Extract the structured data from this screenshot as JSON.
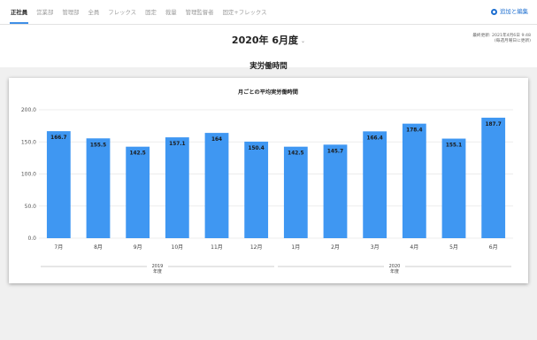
{
  "tabs": [
    {
      "label": "正社員",
      "active": true
    },
    {
      "label": "営業部",
      "active": false
    },
    {
      "label": "管理部",
      "active": false
    },
    {
      "label": "全員",
      "active": false
    },
    {
      "label": "フレックス",
      "active": false
    },
    {
      "label": "固定",
      "active": false
    },
    {
      "label": "裁量",
      "active": false
    },
    {
      "label": "管理監督者",
      "active": false
    },
    {
      "label": "固定+フレックス",
      "active": false
    }
  ],
  "toolbar": {
    "add_edit_label": "追加と編集"
  },
  "header": {
    "period": "2020年 6月度",
    "last_update": "最終更新: 2021年4月6日 9:48",
    "update_note": "(毎週月曜日に更新)"
  },
  "section_title": "実労働時間",
  "colors": {
    "bar": "#3f97f2",
    "accent": "#1e6fd0",
    "grid": "#e6e6e6"
  },
  "chart_data": {
    "type": "bar",
    "title": "月ごとの平均実労働時間",
    "categories": [
      "7月",
      "8月",
      "9月",
      "10月",
      "11月",
      "12月",
      "1月",
      "2月",
      "3月",
      "4月",
      "5月",
      "6月"
    ],
    "values": [
      166.7,
      155.5,
      142.5,
      157.1,
      164,
      150.4,
      142.5,
      145.7,
      166.4,
      178.4,
      155.1,
      187.7
    ],
    "value_labels": [
      "166.7",
      "155.5",
      "142.5",
      "157.1",
      "164",
      "150.4",
      "142.5",
      "145.7",
      "166.4",
      "178.4",
      "155.1",
      "187.7"
    ],
    "ylim": [
      0,
      200
    ],
    "yticks": [
      "0.0",
      "50.0",
      "100.0",
      "150.0",
      "200.0"
    ],
    "ytick_values": [
      0,
      50,
      100,
      150,
      200
    ],
    "groups": [
      {
        "year": "2019",
        "unit": "年度",
        "count": 6
      },
      {
        "year": "2020",
        "unit": "年度",
        "count": 6
      }
    ],
    "grid": true,
    "legend": "none"
  }
}
